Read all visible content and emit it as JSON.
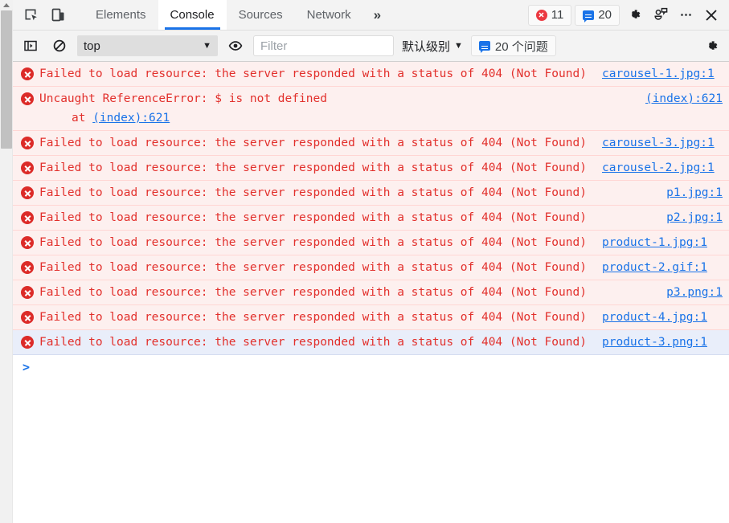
{
  "toolbar": {
    "inspect_icon": "inspect-element-icon",
    "device_icon": "device-toolbar-icon",
    "tabs": [
      {
        "label": "Elements",
        "active": false
      },
      {
        "label": "Console",
        "active": true
      },
      {
        "label": "Sources",
        "active": false
      },
      {
        "label": "Network",
        "active": false
      }
    ],
    "more_tabs_label": "»",
    "error_count": "11",
    "message_count": "20",
    "settings_icon": "gear-icon",
    "feedback_icon": "feedback-icon",
    "more_icon": "more-options-icon",
    "close_icon": "close-icon"
  },
  "filterbar": {
    "sidebar_toggle_icon": "console-sidebar-icon",
    "clear_icon": "clear-console-icon",
    "context_value": "top",
    "caret": "▼",
    "eye_icon": "live-expression-icon",
    "filter_placeholder": "Filter",
    "filter_value": "",
    "levels_label": "默认级别",
    "levels_caret": "▼",
    "issues_label": "20 个问题",
    "settings_icon": "console-settings-gear-icon"
  },
  "console": {
    "prompt_caret": ">",
    "messages": [
      {
        "level": "error",
        "text": "Failed to load resource: the server responded with a status of 404 (Not Found)",
        "source": "carousel-1.jpg:1",
        "wrapped": true,
        "selected": false
      },
      {
        "level": "error",
        "text": "Uncaught ReferenceError: $ is not defined",
        "stack_prefix": "at ",
        "stack_link": "(index):621",
        "source": "(index):621",
        "wrapped": false,
        "selected": false
      },
      {
        "level": "error",
        "text": "Failed to load resource: the server responded with a status of 404 (Not Found)",
        "source": "carousel-3.jpg:1",
        "wrapped": true,
        "selected": false
      },
      {
        "level": "error",
        "text": "Failed to load resource: the server responded with a status of 404 (Not Found)",
        "source": "carousel-2.jpg:1",
        "wrapped": true,
        "selected": false
      },
      {
        "level": "error",
        "text": "Failed to load resource: the server responded with a status of 404 (Not Found)",
        "source": "p1.jpg:1",
        "wrapped": false,
        "selected": false
      },
      {
        "level": "error",
        "text": "Failed to load resource: the server responded with a status of 404 (Not Found)",
        "source": "p2.jpg:1",
        "wrapped": false,
        "selected": false
      },
      {
        "level": "error",
        "text": "Failed to load resource: the server responded with a status of 404 (Not Found)",
        "source": "product-1.jpg:1",
        "wrapped": true,
        "selected": false
      },
      {
        "level": "error",
        "text": "Failed to load resource: the server responded with a status of 404 (Not Found)",
        "source": "product-2.gif:1",
        "wrapped": true,
        "selected": false
      },
      {
        "level": "error",
        "text": "Failed to load resource: the server responded with a status of 404 (Not Found)",
        "source": "p3.png:1",
        "wrapped": false,
        "selected": false
      },
      {
        "level": "error",
        "text": "Failed to load resource: the server responded with a status of 404 (Not Found)",
        "source": "product-4.jpg:1",
        "wrapped": true,
        "selected": false
      },
      {
        "level": "error",
        "text": "Failed to load resource: the server responded with a status of 404 (Not Found)",
        "source": "product-3.png:1",
        "wrapped": true,
        "selected": true
      }
    ]
  },
  "colors": {
    "error_text": "#e2302c",
    "error_bg": "#fdf0ef",
    "selected_bg": "#e9eefa",
    "link": "#1a73e8",
    "accent": "#1a73e8",
    "toolbar_bg": "#f3f3f3"
  }
}
